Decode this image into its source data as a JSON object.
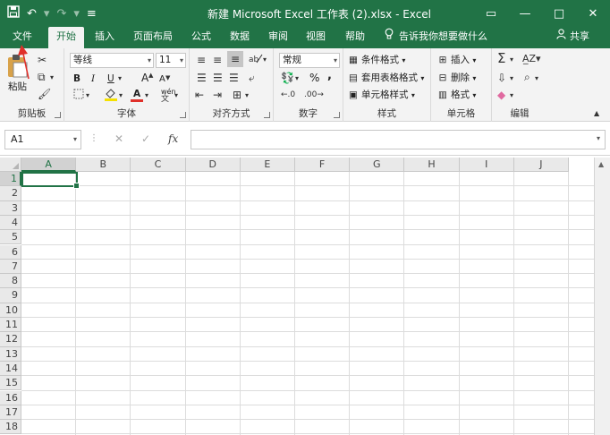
{
  "titlebar": {
    "title": "新建 Microsoft Excel 工作表 (2).xlsx  -  Excel",
    "restore_icon": "▭",
    "minimize_icon": "—",
    "maximize_icon": "□",
    "close_icon": "✕"
  },
  "tabs": [
    "文件",
    "开始",
    "插入",
    "页面布局",
    "公式",
    "数据",
    "审阅",
    "视图",
    "帮助"
  ],
  "active_tab": "开始",
  "tell_me": "告诉我你想要做什么",
  "share": "共享",
  "ribbon": {
    "clipboard": {
      "paste": "粘贴",
      "label": "剪贴板"
    },
    "font": {
      "name": "等线",
      "size": "11",
      "bold": "B",
      "italic": "I",
      "underline": "U",
      "grow": "A",
      "shrink": "A",
      "font_color": "A",
      "phonetic": "wén",
      "label": "字体"
    },
    "alignment": {
      "label": "对齐方式"
    },
    "number": {
      "format": "常规",
      "percent": "%",
      "comma": ",",
      "label": "数字"
    },
    "styles": {
      "conditional": "条件格式",
      "table": "套用表格格式",
      "cell_styles": "单元格样式",
      "label": "样式"
    },
    "cells": {
      "insert": "插入",
      "delete": "删除",
      "format": "格式",
      "label": "单元格"
    },
    "editing": {
      "label": "编辑"
    }
  },
  "formula_bar": {
    "name_box": "A1",
    "fx": "fx",
    "value": ""
  },
  "grid": {
    "columns": [
      "A",
      "B",
      "C",
      "D",
      "E",
      "F",
      "G",
      "H",
      "I",
      "J"
    ],
    "rows": [
      "1",
      "2",
      "3",
      "4",
      "5",
      "6",
      "7",
      "8",
      "9",
      "10",
      "11",
      "12",
      "13",
      "14",
      "15",
      "16",
      "17",
      "18"
    ],
    "active_cell": "A1"
  },
  "colors": {
    "accent": "#217346",
    "annotation": "#e0302a"
  }
}
